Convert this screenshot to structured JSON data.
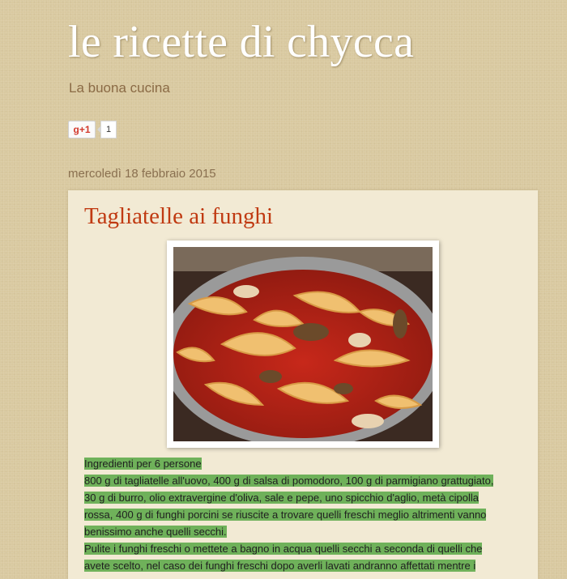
{
  "blog": {
    "title": "le ricette di chycca",
    "description": "La buona cucina"
  },
  "social": {
    "gplus_label": "g+1",
    "gplus_count": "1"
  },
  "post": {
    "date": "mercoledì 18 febbraio 2015",
    "title": "Tagliatelle ai funghi",
    "image_icon": "pasta-photo",
    "lines": [
      "Ingredienti per 6 persone",
      "800 g di tagliatelle all'uovo, 400 g di salsa di pomodoro, 100 g di parmigiano grattugiato,",
      "30 g di burro, olio extravergine d'oliva, sale e pepe, uno spicchio d'aglio, metà cipolla",
      "rossa, 400 g di funghi porcini se riuscite a trovare quelli freschi meglio altrimenti vanno",
      "benissimo anche quelli secchi.",
      "Pulite i funghi freschi o mettete a bagno in acqua quelli secchi a seconda di quelli che",
      "avete scelto, nel caso dei funghi freschi dopo averli lavati andranno affettati mentre i"
    ]
  },
  "colors": {
    "title": "#ffffff",
    "post_title": "#c03a12",
    "highlight": "#6fb15a",
    "background": "#d9c9a0"
  }
}
